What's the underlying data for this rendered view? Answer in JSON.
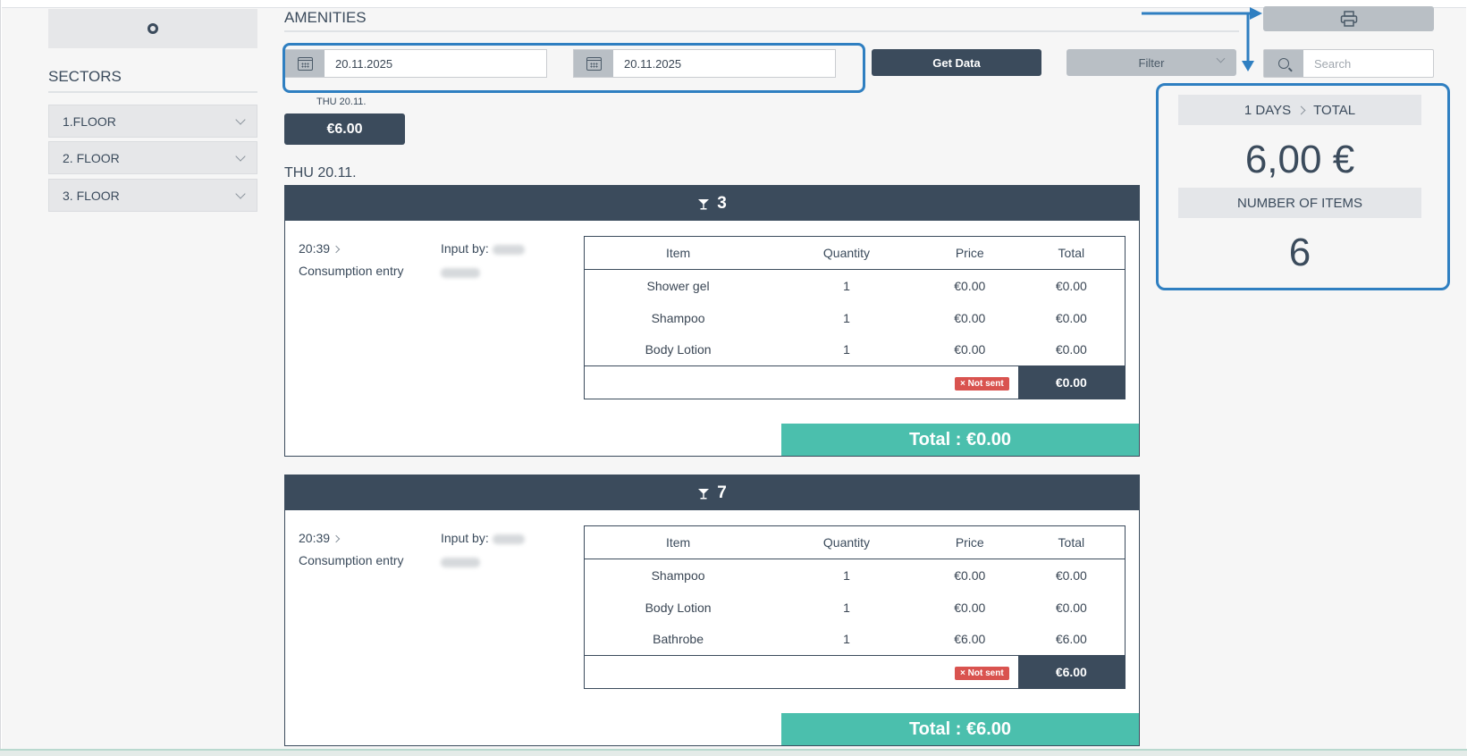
{
  "sidebar": {
    "sectors_title": "SECTORS",
    "sectors": [
      {
        "label": "1.FLOOR"
      },
      {
        "label": "2. FLOOR"
      },
      {
        "label": "3. FLOOR"
      }
    ]
  },
  "header": {
    "title": "AMENITIES",
    "date_from": "20.11.2025",
    "date_to": "20.11.2025",
    "get_data_label": "Get Data",
    "filter_label": "Filter",
    "search_placeholder": "Search"
  },
  "day_chip": {
    "label": "THU 20.11.",
    "amount": "€6.00"
  },
  "day_heading": "THU 20.11.",
  "summary": {
    "days_label": "1 DAYS",
    "total_label": "TOTAL",
    "total_value": "6,00 €",
    "items_label": "NUMBER OF ITEMS",
    "items_value": "6"
  },
  "table_headers": {
    "item": "Item",
    "quantity": "Quantity",
    "price": "Price",
    "total": "Total"
  },
  "rooms": [
    {
      "room": "3",
      "time": "20:39",
      "type": "Consumption entry",
      "input_by_label": "Input by:",
      "rows": [
        {
          "item": "Shower gel",
          "quantity": "1",
          "price": "€0.00",
          "total": "€0.00"
        },
        {
          "item": "Shampoo",
          "quantity": "1",
          "price": "€0.00",
          "total": "€0.00"
        },
        {
          "item": "Body Lotion",
          "quantity": "1",
          "price": "€0.00",
          "total": "€0.00"
        }
      ],
      "status": "Not sent",
      "subtotal": "€0.00",
      "total_label": "Total : €0.00"
    },
    {
      "room": "7",
      "time": "20:39",
      "type": "Consumption entry",
      "input_by_label": "Input by:",
      "rows": [
        {
          "item": "Shampoo",
          "quantity": "1",
          "price": "€0.00",
          "total": "€0.00"
        },
        {
          "item": "Body Lotion",
          "quantity": "1",
          "price": "€0.00",
          "total": "€0.00"
        },
        {
          "item": "Bathrobe",
          "quantity": "1",
          "price": "€6.00",
          "total": "€6.00"
        }
      ],
      "status": "Not sent",
      "subtotal": "€6.00",
      "total_label": "Total : €6.00"
    }
  ],
  "icons": {
    "logo": "logo-ring-icon",
    "calendar": "calendar-icon",
    "search": "search-icon",
    "print": "printer-icon",
    "room": "cocktail-glass-icon"
  },
  "colors": {
    "primary_dark": "#3b4b5c",
    "accent_teal": "#4bbfad",
    "annotation_blue": "#2f7fc1",
    "status_red": "#d9534f"
  }
}
